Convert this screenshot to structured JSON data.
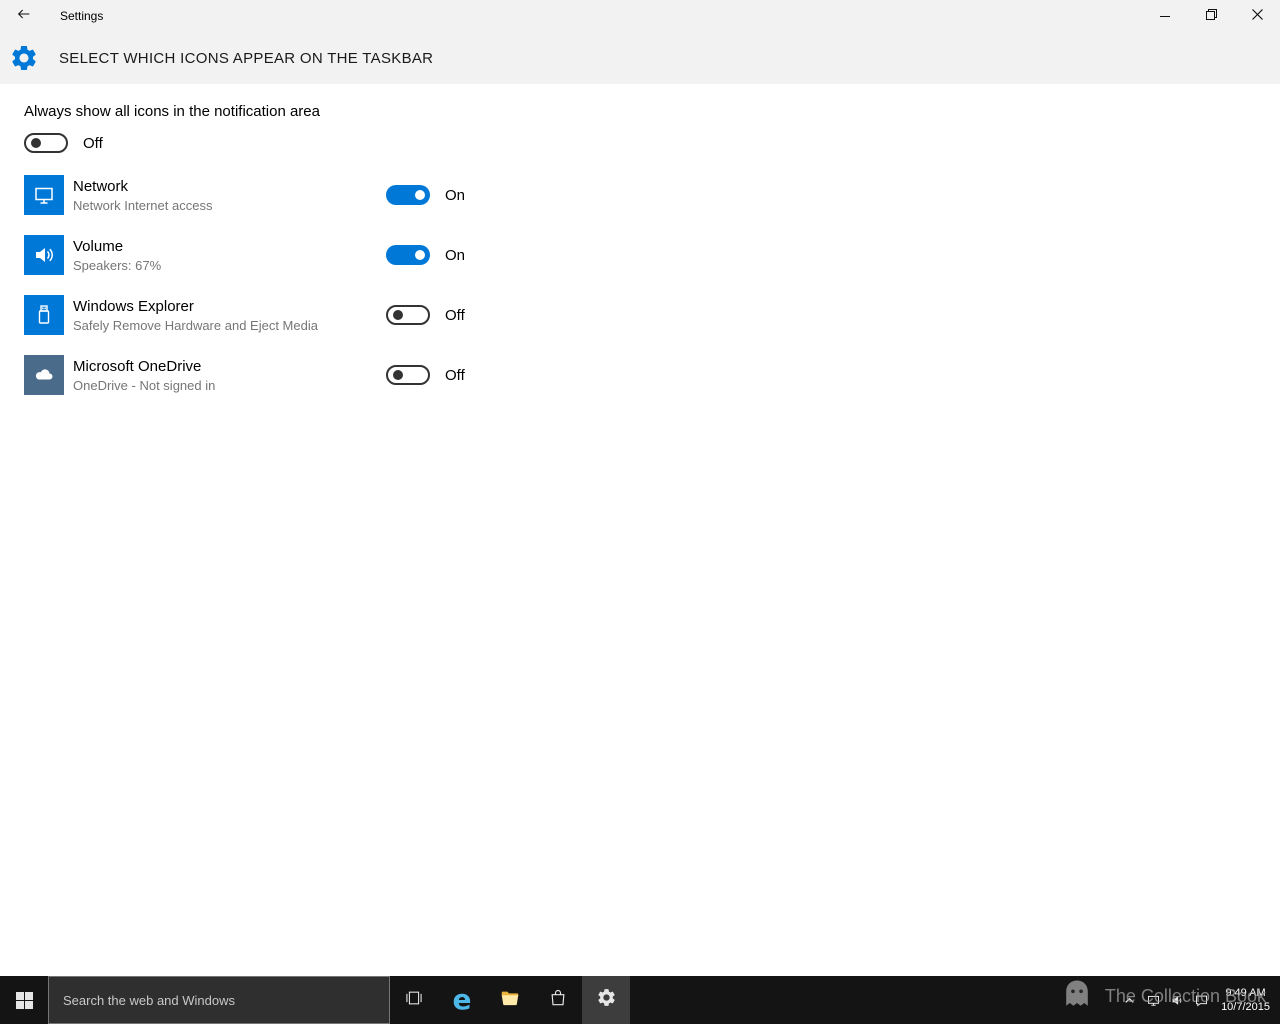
{
  "colors": {
    "accent": "#0078d7",
    "taskbar_bg": "#141414",
    "onedrive_tile": "#4a6b8a"
  },
  "titlebar": {
    "title": "Settings"
  },
  "page": {
    "title": "SELECT WHICH ICONS APPEAR ON THE TASKBAR"
  },
  "master": {
    "label": "Always show all icons in the notification area",
    "state": "Off"
  },
  "items": [
    {
      "name": "Network",
      "desc": "Network Internet access",
      "state": "On",
      "icon": "network-icon"
    },
    {
      "name": "Volume",
      "desc": "Speakers: 67%",
      "state": "On",
      "icon": "volume-icon"
    },
    {
      "name": "Windows Explorer",
      "desc": "Safely Remove Hardware and Eject Media",
      "state": "Off",
      "icon": "usb-eject-icon"
    },
    {
      "name": "Microsoft OneDrive",
      "desc": "OneDrive - Not signed in",
      "state": "Off",
      "icon": "onedrive-cloud-icon"
    }
  ],
  "taskbar": {
    "search_placeholder": "Search the web and Windows",
    "apps": [
      "start",
      "task-view",
      "edge",
      "file-explorer",
      "store",
      "settings"
    ],
    "active_app": "settings"
  },
  "tray": {
    "icons": [
      "chevron-up-icon",
      "network-tray-icon",
      "volume-tray-icon",
      "action-center-icon"
    ],
    "time": "9:49 AM",
    "date": "10/7/2015"
  },
  "watermark": {
    "text": "The Collection Book"
  }
}
